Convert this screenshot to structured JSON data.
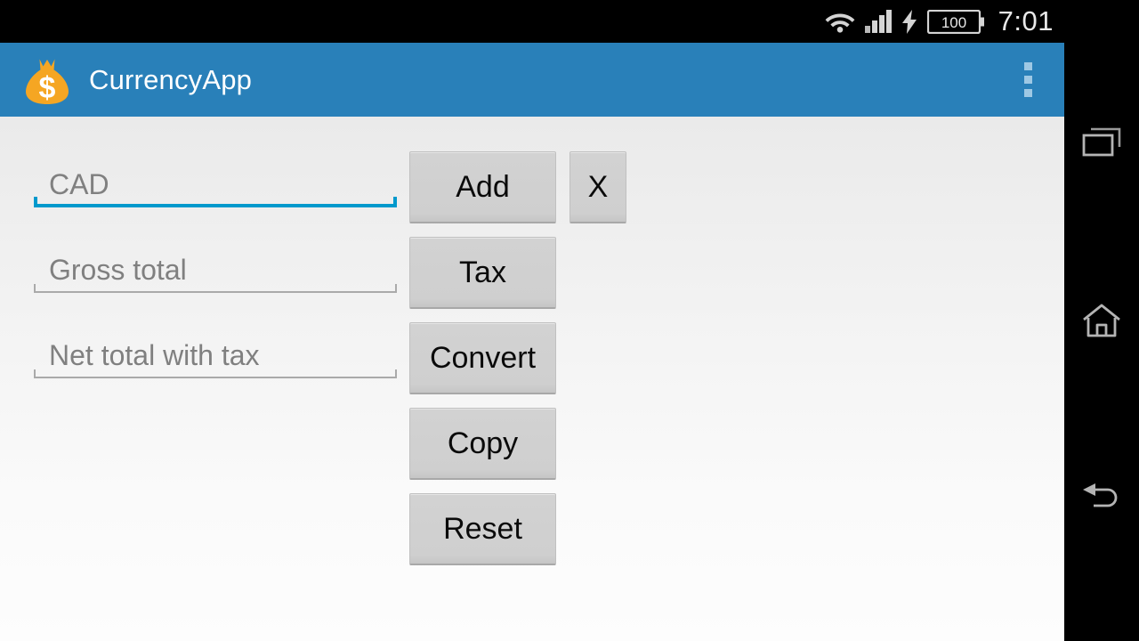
{
  "status_bar": {
    "clock": "7:01",
    "battery_level": "100",
    "icons": [
      "wifi-icon",
      "signal-bars-icon",
      "charging-bolt-icon",
      "battery-icon"
    ]
  },
  "action_bar": {
    "title": "CurrencyApp",
    "app_icon": "money-bag-icon",
    "overflow_icon": "overflow-menu-icon",
    "background_color": "#2980b9",
    "title_color": "#ffffff",
    "icon_color": "#f5a623"
  },
  "fields": [
    {
      "placeholder": "CAD",
      "value": "",
      "focused": true,
      "accent_color": "#0099cc"
    },
    {
      "placeholder": "Gross total",
      "value": "",
      "focused": false,
      "accent_color": "#aaaaaa"
    },
    {
      "placeholder": "Net total with tax",
      "value": "",
      "focused": false,
      "accent_color": "#aaaaaa"
    }
  ],
  "buttons": {
    "add": "Add",
    "clear": "X",
    "tax": "Tax",
    "convert": "Convert",
    "copy": "Copy",
    "reset": "Reset"
  },
  "nav_bar": {
    "recents": "recents-icon",
    "home": "home-icon",
    "back": "back-icon"
  }
}
